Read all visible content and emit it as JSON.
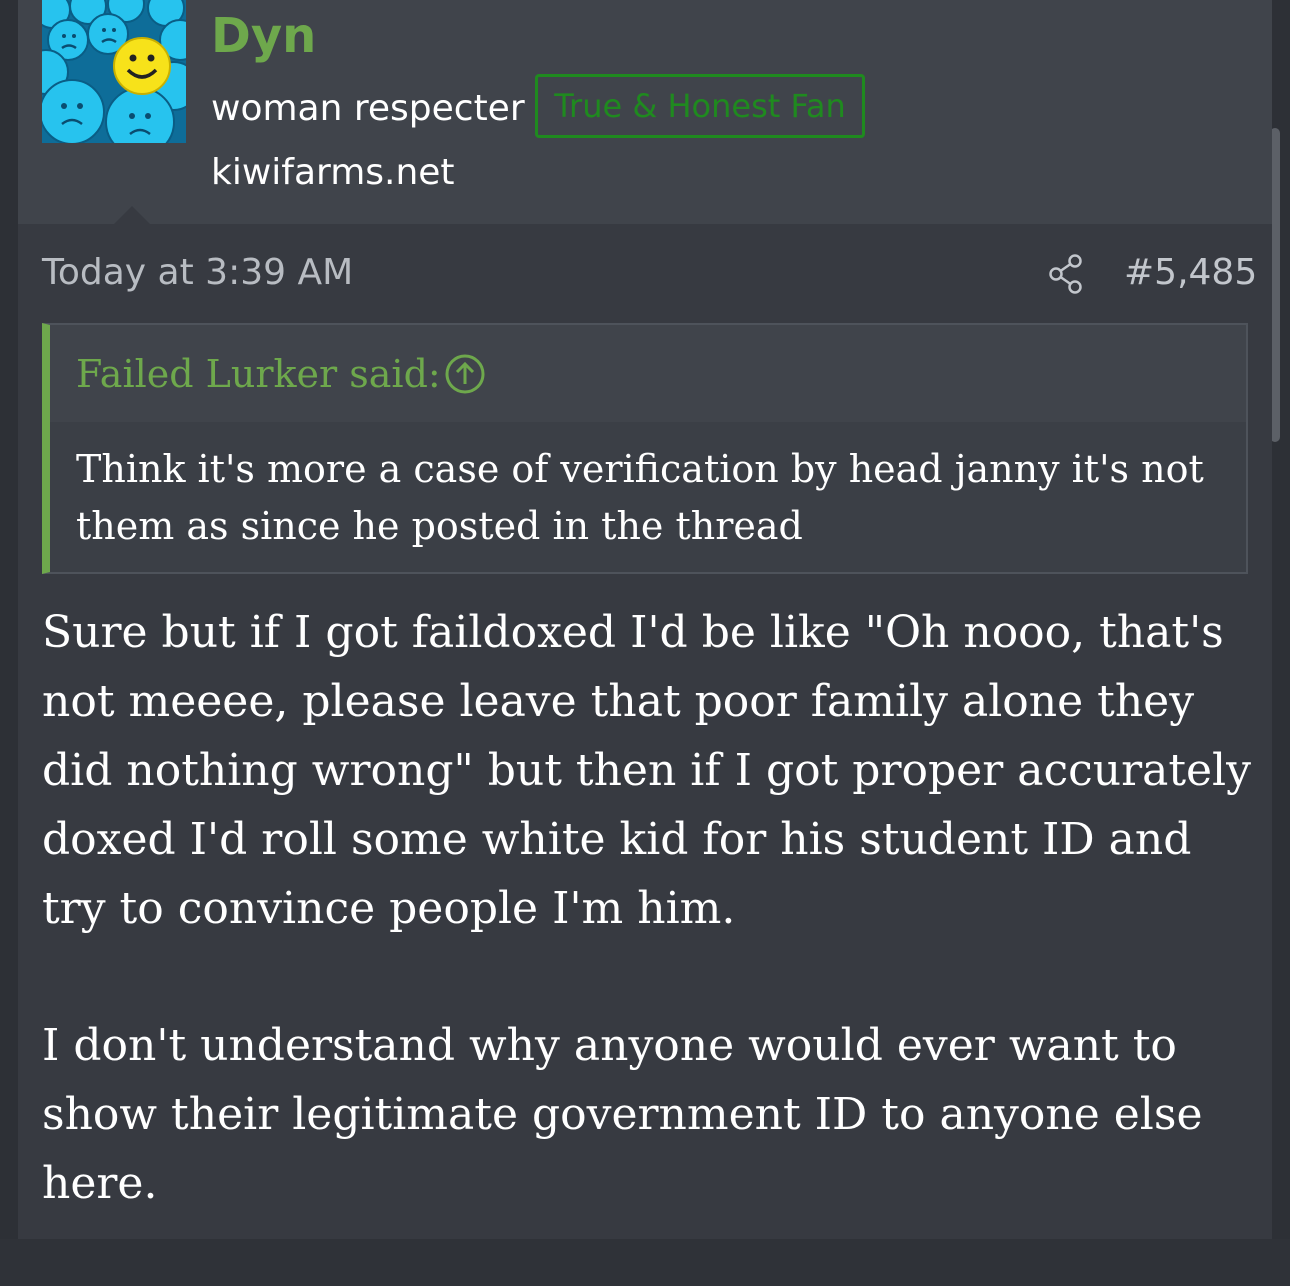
{
  "user": {
    "name": "Dyn",
    "title": "woman respecter",
    "banner": "True & Honest Fan",
    "extra": "kiwifarms.net"
  },
  "post": {
    "date": "Today at 3:39 AM",
    "number": "#5,485",
    "quote": {
      "attribution": "Failed Lurker said:",
      "text": "Think it's more a case of verification by head janny it's not them as since he posted in the thread"
    },
    "paragraphs": [
      "Sure but if I got faildoxed I'd be like \"Oh nooo, that's not meeee, please leave that poor family alone they did nothing wrong\" but then if I got proper accurately doxed I'd roll some white kid for his student ID and try to convince people I'm him.",
      "I don't understand why anyone would ever want to show their legitimate government ID to anyone else here."
    ]
  },
  "icons": {
    "share": "share-icon",
    "quote_jump": "arrow-up-circle-icon"
  },
  "colors": {
    "accent_green": "#6ea84c",
    "banner_green": "#1f8a1f",
    "header_bg": "#40444b",
    "body_bg": "#373a41"
  }
}
